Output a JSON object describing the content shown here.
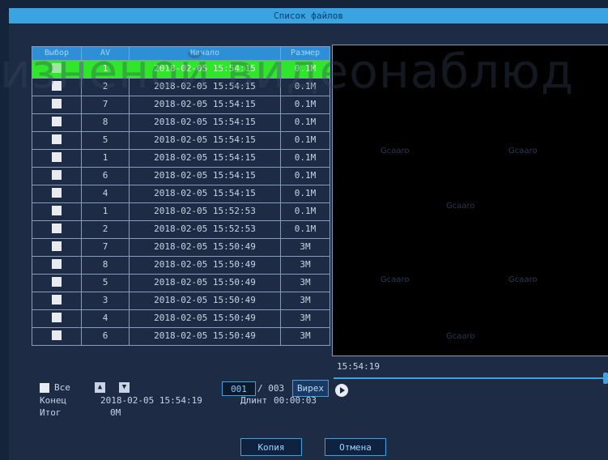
{
  "title": "Список файлов",
  "table": {
    "headers": {
      "select": "Выбор",
      "channel": "AV",
      "start": "Начало",
      "size": "Размер"
    },
    "rows": [
      {
        "channel": "1",
        "start": "2018-02-05 15:54:15",
        "size": "0.1M",
        "selected": true,
        "checked": true
      },
      {
        "channel": "2",
        "start": "2018-02-05 15:54:15",
        "size": "0.1M"
      },
      {
        "channel": "7",
        "start": "2018-02-05 15:54:15",
        "size": "0.1M"
      },
      {
        "channel": "8",
        "start": "2018-02-05 15:54:15",
        "size": "0.1M"
      },
      {
        "channel": "5",
        "start": "2018-02-05 15:54:15",
        "size": "0.1M"
      },
      {
        "channel": "1",
        "start": "2018-02-05 15:54:15",
        "size": "0.1M"
      },
      {
        "channel": "6",
        "start": "2018-02-05 15:54:15",
        "size": "0.1M"
      },
      {
        "channel": "4",
        "start": "2018-02-05 15:54:15",
        "size": "0.1M"
      },
      {
        "channel": "1",
        "start": "2018-02-05 15:52:53",
        "size": "0.1M"
      },
      {
        "channel": "2",
        "start": "2018-02-05 15:52:53",
        "size": "0.1M"
      },
      {
        "channel": "7",
        "start": "2018-02-05 15:50:49",
        "size": "3M"
      },
      {
        "channel": "8",
        "start": "2018-02-05 15:50:49",
        "size": "3M"
      },
      {
        "channel": "5",
        "start": "2018-02-05 15:50:49",
        "size": "3M"
      },
      {
        "channel": "3",
        "start": "2018-02-05 15:50:49",
        "size": "3M"
      },
      {
        "channel": "4",
        "start": "2018-02-05 15:50:49",
        "size": "3M"
      },
      {
        "channel": "6",
        "start": "2018-02-05 15:50:49",
        "size": "3M"
      }
    ]
  },
  "controls": {
    "all_label": "Все",
    "page_current": "001",
    "page_total": "/ 003",
    "goto_label": "Вирех"
  },
  "preview": {
    "time": "15:54:19",
    "progress": 1.0
  },
  "info": {
    "end_label": "Конец",
    "end_value": "2018-02-05 15:54:19",
    "total_label": "Итог",
    "total_value": "0M",
    "duration_label": "Длинт",
    "duration_value": "00:00:03"
  },
  "buttons": {
    "copy_label": "Копия",
    "cancel_label": "Отмена"
  },
  "watermark": {
    "big_text": "изненой видеонаблюд",
    "small_text": "Gcaaro"
  },
  "colors": {
    "title_bar": "#3aa4e2",
    "selected_row": "#2fe62a",
    "background": "#14243a"
  }
}
